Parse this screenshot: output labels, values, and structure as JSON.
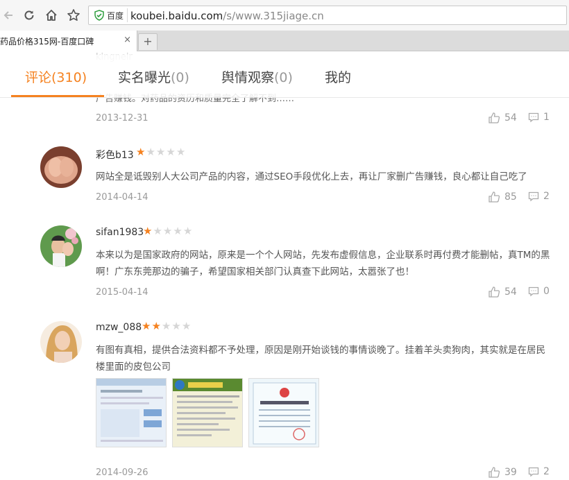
{
  "browser": {
    "secure_label": "百度",
    "url_host": "koubei.baidu.com",
    "url_path": "/s/www.315jiage.cn",
    "url_prefix": "",
    "tab_title": "药品价格315网-百度口碑",
    "new_tab_label": "+"
  },
  "subnav": {
    "tabs": [
      {
        "label": "评论",
        "count": "(310)"
      },
      {
        "label": "实名曝光",
        "count": "(0)"
      },
      {
        "label": "舆情观察",
        "count": "(0)"
      },
      {
        "label": "我的",
        "count": ""
      }
    ]
  },
  "ghost_username": "kingneir",
  "first_review": {
    "body_fragment": "广告赚钱。对药品的资历和质量完全了解不到……",
    "date": "2013-12-31",
    "likes": "54",
    "comments": "1"
  },
  "reviews": [
    {
      "username": "彩色b13",
      "rating": 1,
      "body": "网站全是诋毁别人大公司产品的内容，通过SEO手段优化上去，再让厂家删广告赚钱，良心都让自己吃了",
      "date": "2014-04-14",
      "likes": "85",
      "comments": "2",
      "avatar_color": "#c9836a"
    },
    {
      "username": "sifan1983",
      "rating": 1,
      "body": "本来以为是国家政府的网站，原来是一个个人网站，先发布虚假信息，企业联系时再付费才能删帖，真TM的黑啊！广东东莞那边的骗子，希望国家相关部门认真查下此网站，太嚣张了也！",
      "date": "2015-04-14",
      "likes": "54",
      "comments": "0",
      "avatar_color": "#6aa55a"
    },
    {
      "username": "mzw_088",
      "rating": 2,
      "body": "有图有真相，提供合法资料都不予处理，原因是刚开始谈钱的事情谈晚了。挂着羊头卖狗肉，其实就是在居民楼里面的皮包公司",
      "date": "2014-09-26",
      "likes": "39",
      "comments": "2",
      "avatar_color": "#e6b48a"
    }
  ],
  "colors": {
    "accent": "#f58220",
    "star_off": "#d6d6d6",
    "secure_green": "#2e9e3e"
  }
}
